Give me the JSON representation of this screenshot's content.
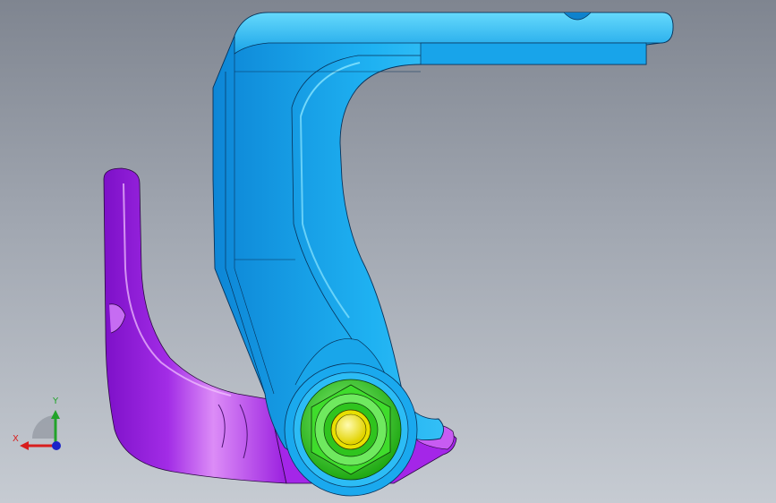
{
  "viewport": {
    "background_top": "#7f8590",
    "background_bottom": "#c6cbd2"
  },
  "parts": {
    "bracket": {
      "color": "#1fb2f2",
      "shape": "inverted-L arm with pivot boss"
    },
    "hook": {
      "color": "#a22ce6",
      "shape": "curved hook plate"
    },
    "hex_nut": {
      "color": "#2fd61e"
    },
    "bolt": {
      "color": "#f4ee05"
    }
  },
  "triad": {
    "x_label": "X",
    "y_label": "Y",
    "x_color": "#d81e1e",
    "y_color": "#22a32a",
    "z_color": "#1b24c9"
  }
}
